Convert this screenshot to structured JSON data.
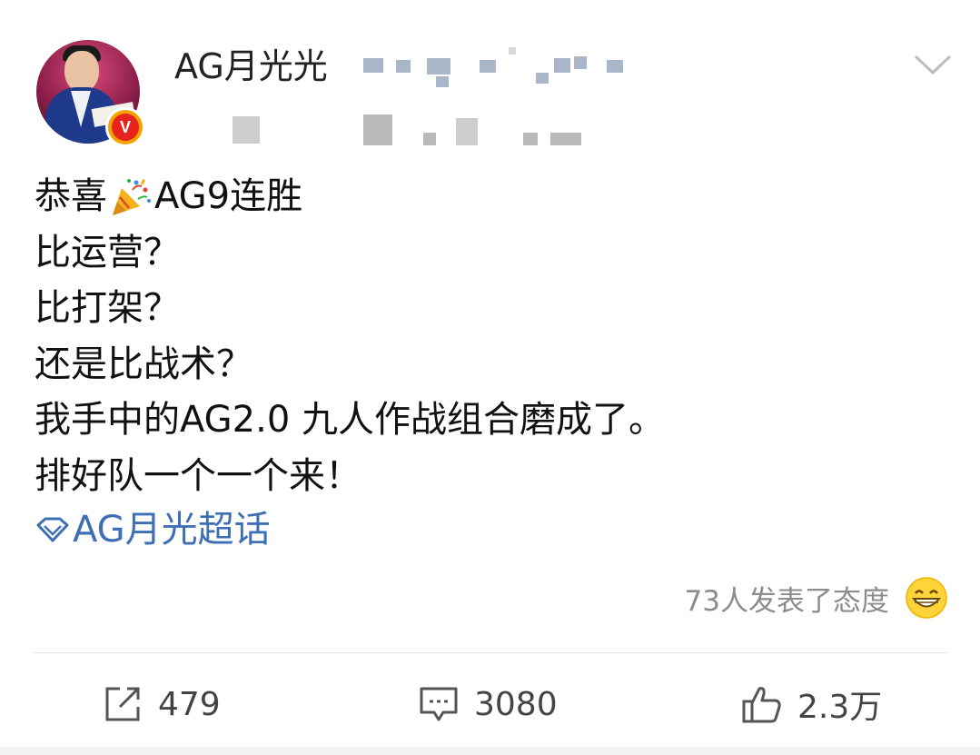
{
  "header": {
    "username": "AG月光光",
    "verified_badge": "V",
    "icons": {
      "more": "chevron-down-icon"
    }
  },
  "post": {
    "lines": [
      {
        "before": "恭喜",
        "emoji": "party-popper-icon",
        "after": "AG9连胜"
      },
      {
        "text": "比运营？"
      },
      {
        "text": "比打架？"
      },
      {
        "text": "还是比战术？"
      },
      {
        "text": "我手中的AG2.0 九人作战组合磨成了。"
      },
      {
        "text": "排好队一个一个来！"
      }
    ],
    "topic": {
      "icon": "super-topic-diamond-icon",
      "label": "AG月光超话"
    }
  },
  "reactions": {
    "attitude_text": "73人发表了态度",
    "emoji": "grin-emoji-icon"
  },
  "actions": {
    "repost_count": "479",
    "comment_count": "3080",
    "like_count": "2.3万"
  },
  "colors": {
    "topic_link": "#3e6fb5",
    "verified_outer": "#f5a300",
    "verified_inner": "#e8231b",
    "muted_text": "#8c8c8c"
  }
}
